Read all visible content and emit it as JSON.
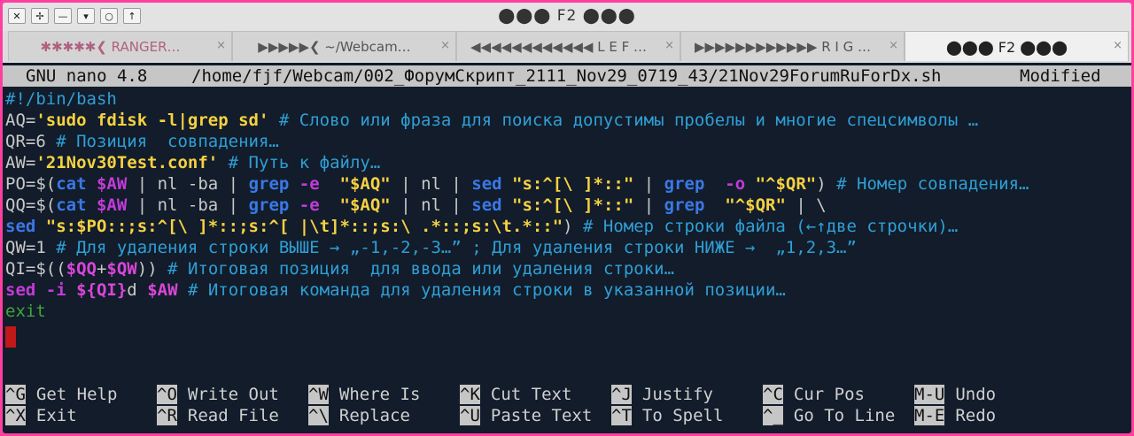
{
  "window": {
    "title": "⬤⬤⬤ F2 ⬤⬤⬤",
    "buttons": [
      "✕",
      "✢",
      "—",
      "▾",
      "○",
      "↑"
    ]
  },
  "tabs": [
    {
      "label": "✱✱✱✱✱❮ RANGER…",
      "close": "×"
    },
    {
      "label": "▶▶▶▶▶❮ ~/Webcam…",
      "close": "×"
    },
    {
      "label": "◀◀◀◀◀◀◀◀◀◀◀◀ L E F …",
      "close": "×"
    },
    {
      "label": "▶▶▶▶▶▶▶▶▶▶▶▶ R I G …",
      "close": "×"
    },
    {
      "label": "⬤⬤⬤ F2 ⬤⬤⬤",
      "close": "×"
    }
  ],
  "nano": {
    "version": "GNU nano 4.8",
    "path": "/home/fjf/Webcam/002_ФорумСкрипт_2111_Nov29_0719_43/21Nov29ForumRuForDx.sh",
    "status": "Modified"
  },
  "code": {
    "l1": "#!/bin/bash",
    "l2": {
      "a": "AQ=",
      "b": "'sudo fdisk -l|grep sd'",
      "c": " # Слово или фраза для поиска допустимы пробелы и многие спецсимволы …"
    },
    "l3": {
      "a": "QR=6",
      "c": " # Позиция  совпадения…"
    },
    "l4": {
      "a": "AW=",
      "b": "'21Nov30Test.conf'",
      "c": " # Путь к файлу…"
    },
    "l5": {
      "p1": "PO=$(",
      "k1": "cat",
      "v1": " $AW",
      "p2": " | nl -ba | ",
      "k2": "grep",
      "v2": " -e",
      "s1": "  \"$AQ\"",
      "p3": " | nl | ",
      "k3": "sed",
      "s2": " \"s:^[\\ ]*::\"",
      "p4": " | ",
      "k4": "grep",
      "v3": "  -o",
      "s3": " \"^$QR\"",
      "p5": ")",
      "c": " # Номер совпадения…"
    },
    "l6": {
      "p1": "QQ=$(",
      "k1": "cat",
      "v1": " $AW",
      "p2": " | nl -ba | ",
      "k2": "grep",
      "v2": " -e",
      "s1": "  \"$AQ\"",
      "p3": " | nl | ",
      "k3": "sed",
      "s2": " \"s:^[\\ ]*::\"",
      "p4": " | ",
      "k4": "grep",
      "s3": "  \"^$QR\"",
      "p5": " | \\"
    },
    "l7": {
      "k1": "sed",
      "s1": " \"s:$PO::;s:^[\\ ]*::;s:^[ |\\t]*::;s:\\ .*::;s:\\t.*::\"",
      "p1": ")",
      "c": " # Номер строки файла (←↑две строчки)…"
    },
    "l8": {
      "a": "QW=1",
      "c": " # Для удаления строки ВЫШЕ → „-1,-2,-3…” ; Для удаления строки НИЖЕ →  „1,2,3…”"
    },
    "l9": {
      "p1": "QI=$((",
      "v1": "$QQ",
      "p2": "+",
      "v2": "$QW",
      "p3": "))",
      "c": " # Итоговая позиция  для ввода или удаления строки…"
    },
    "l10": {
      "k1": "sed",
      "v1": " -i ",
      "v2": "${QI}",
      "p1": "d ",
      "v3": "$AW",
      "c": " # Итоговая команда для удаления строки в указанной позиции…"
    },
    "l11": "exit"
  },
  "shortcuts": [
    {
      "key": "^G",
      "label": "Get Help"
    },
    {
      "key": "^O",
      "label": "Write Out"
    },
    {
      "key": "^W",
      "label": "Where Is"
    },
    {
      "key": "^K",
      "label": "Cut Text"
    },
    {
      "key": "^J",
      "label": "Justify"
    },
    {
      "key": "^C",
      "label": "Cur Pos"
    },
    {
      "key": "M-U",
      "label": "Undo"
    },
    {
      "key": "^X",
      "label": "Exit"
    },
    {
      "key": "^R",
      "label": "Read File"
    },
    {
      "key": "^\\",
      "label": "Replace"
    },
    {
      "key": "^U",
      "label": "Paste Text"
    },
    {
      "key": "^T",
      "label": "To Spell"
    },
    {
      "key": "^_",
      "label": "Go To Line"
    },
    {
      "key": "M-E",
      "label": "Redo"
    }
  ],
  "colors": {
    "comment": "#2f9fd6",
    "string": "#f5d142",
    "keyword": "#3a78e6",
    "variable": "#c23bd9",
    "background": "#121c2a",
    "cursor": "#c11919"
  }
}
